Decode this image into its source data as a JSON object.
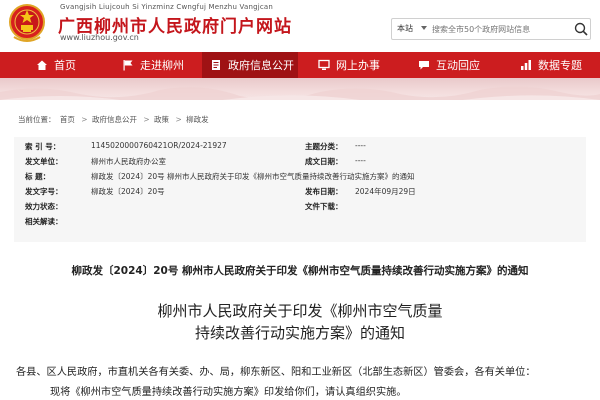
{
  "header": {
    "pinyin": "Gvangjsih Liujcouh Si Yinzminz Cwngfuj Menzhu Vangjcan",
    "title": "广西柳州市人民政府门户网站",
    "url": "www.liuzhou.gov.cn"
  },
  "search": {
    "scope": "本站",
    "placeholder": "搜索全市50个政府网站信息"
  },
  "nav": {
    "items": [
      {
        "label": "首页",
        "icon": "home-icon"
      },
      {
        "label": "走进柳州",
        "icon": "flag-icon"
      },
      {
        "label": "政府信息公开",
        "icon": "document-icon"
      },
      {
        "label": "网上办事",
        "icon": "monitor-icon"
      },
      {
        "label": "互动回应",
        "icon": "chat-icon"
      },
      {
        "label": "数据专题",
        "icon": "data-icon"
      }
    ],
    "active_index": 2
  },
  "breadcrumb": {
    "prefix": "当前位置：",
    "items": [
      "首页",
      "政府信息公开",
      "政策",
      "柳政发"
    ],
    "separator": ">"
  },
  "info": {
    "index_label": "索 引 号：",
    "index_value": "1145020000760421OR/2024-21927",
    "topic_label": "主题分类：",
    "topic_value": "----",
    "issuer_label": "发文单位：",
    "issuer_value": "柳州市人民政府办公室",
    "date_made_label": "成文日期：",
    "date_made_value": "----",
    "title_label": "标    题：",
    "title_value": "柳政发〔2024〕20号 柳州市人民政府关于印发《柳州市空气质量持续改善行动实施方案》的通知",
    "docno_label": "发文字号：",
    "docno_value": "柳政发〔2024〕20号",
    "pubdate_label": "发布日期：",
    "pubdate_value": "2024年09月29日",
    "validity_label": "效力状态：",
    "validity_value": "",
    "download_label": "文件下载：",
    "download_value": "",
    "related_label": "相关解读：",
    "related_value": ""
  },
  "document": {
    "heading": "柳政发〔2024〕20号 柳州市人民政府关于印发《柳州市空气质量持续改善行动实施方案》的通知",
    "body_title_line1": "柳州市人民政府关于印发《柳州市空气质量",
    "body_title_line2": "持续改善行动实施方案》的通知",
    "paragraph1": "各县、区人民政府，市直机关各有关委、办、局，柳东新区、阳和工业新区（北部生态新区）管委会，各有关单位：",
    "paragraph2": "现将《柳州市空气质量持续改善行动实施方案》印发给你们，请认真组织实施。"
  },
  "colors": {
    "brand_red": "#cc1d1f",
    "nav_active": "#9f1214",
    "title_red": "#c4161c"
  }
}
